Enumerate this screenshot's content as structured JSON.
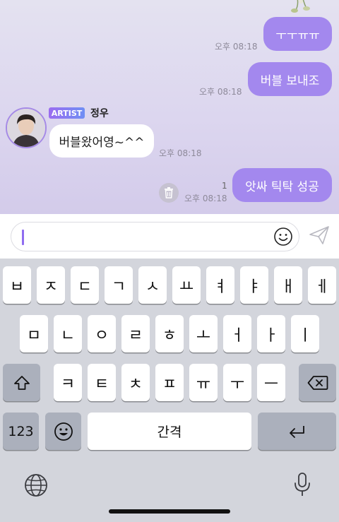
{
  "chat": {
    "messages": [
      {
        "text": "ㅜㅜㅠㅠ",
        "time": "오후 08:18"
      },
      {
        "text": "버블 보내조",
        "time": "오후 08:18"
      },
      {
        "text": "버블왔어영~^^",
        "time": "오후 08:18"
      },
      {
        "text": "앗싸 틱탁 성공",
        "time": "오후 08:18",
        "read": "1"
      }
    ],
    "artist_badge": "ARTIST",
    "sender_name": "정우"
  },
  "input": {
    "value": ""
  },
  "keyboard": {
    "row1": [
      "ㅂ",
      "ㅈ",
      "ㄷ",
      "ㄱ",
      "ㅅ",
      "ㅛ",
      "ㅕ",
      "ㅑ",
      "ㅐ",
      "ㅔ"
    ],
    "row2": [
      "ㅁ",
      "ㄴ",
      "ㅇ",
      "ㄹ",
      "ㅎ",
      "ㅗ",
      "ㅓ",
      "ㅏ",
      "ㅣ"
    ],
    "row3": [
      "ㅋ",
      "ㅌ",
      "ㅊ",
      "ㅍ",
      "ㅠ",
      "ㅜ",
      "ㅡ"
    ],
    "numbers_label": "123",
    "space_label": "간격"
  },
  "colors": {
    "accent": "#a388ee",
    "badge_start": "#9b6cf0",
    "badge_end": "#6f8ff4"
  },
  "icons": [
    "flower-icon",
    "trash-icon",
    "emoji-icon",
    "send-icon",
    "shift-icon",
    "backspace-icon",
    "emoji-keyboard-icon",
    "return-icon",
    "globe-icon",
    "mic-icon"
  ]
}
